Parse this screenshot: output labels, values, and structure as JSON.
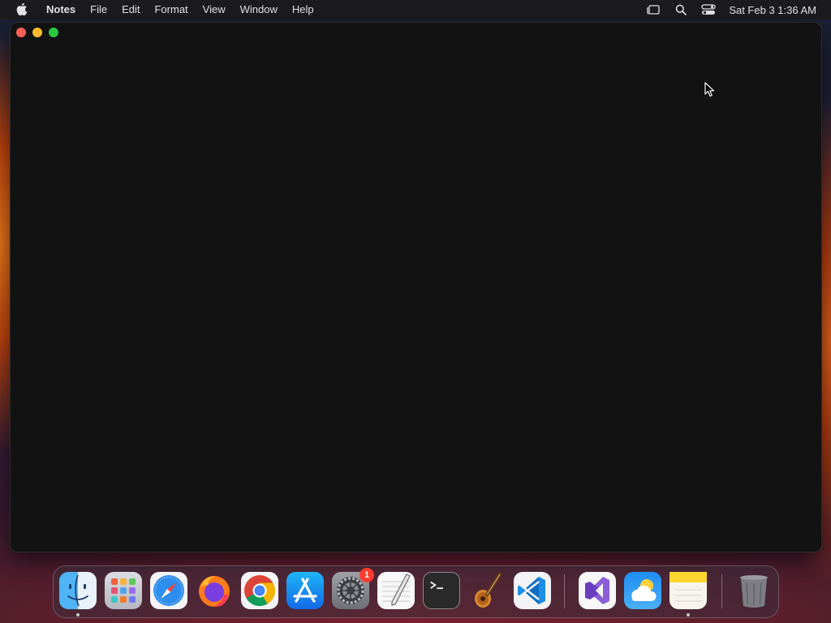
{
  "menubar": {
    "apple_icon": "apple-icon",
    "app_name": "Notes",
    "menus": [
      "File",
      "Edit",
      "Format",
      "View",
      "Window",
      "Help"
    ],
    "status_icons": [
      "stage-manager-icon",
      "spotlight-icon",
      "control-center-icon"
    ],
    "clock": "Sat Feb 3  1:36 AM"
  },
  "window": {
    "background": "#121212",
    "traffic_lights": {
      "close": "#fe5f57",
      "minimize": "#febc2e",
      "maximize": "#28c840"
    }
  },
  "dock": {
    "apps": [
      {
        "name": "Finder",
        "icon": "finder-icon",
        "running": true
      },
      {
        "name": "Launchpad",
        "icon": "launchpad-icon",
        "running": false
      },
      {
        "name": "Safari",
        "icon": "safari-icon",
        "running": false
      },
      {
        "name": "Firefox",
        "icon": "firefox-icon",
        "running": false
      },
      {
        "name": "Google Chrome",
        "icon": "chrome-icon",
        "running": false
      },
      {
        "name": "App Store",
        "icon": "app-store-icon",
        "running": false
      },
      {
        "name": "System Settings",
        "icon": "system-settings-icon",
        "running": false,
        "badge": "1"
      },
      {
        "name": "TextEdit",
        "icon": "textedit-icon",
        "running": false
      },
      {
        "name": "Terminal",
        "icon": "terminal-icon",
        "running": false
      },
      {
        "name": "GarageBand",
        "icon": "garageband-icon",
        "running": false
      },
      {
        "name": "Visual Studio Code",
        "icon": "vscode-icon",
        "running": false
      },
      {
        "name": "Visual Studio",
        "icon": "visual-studio-icon",
        "running": false
      },
      {
        "name": "Weather",
        "icon": "weather-icon",
        "running": false
      },
      {
        "name": "Notes",
        "icon": "notes-icon",
        "running": true
      },
      {
        "name": "Trash",
        "icon": "trash-icon",
        "running": false
      }
    ]
  }
}
